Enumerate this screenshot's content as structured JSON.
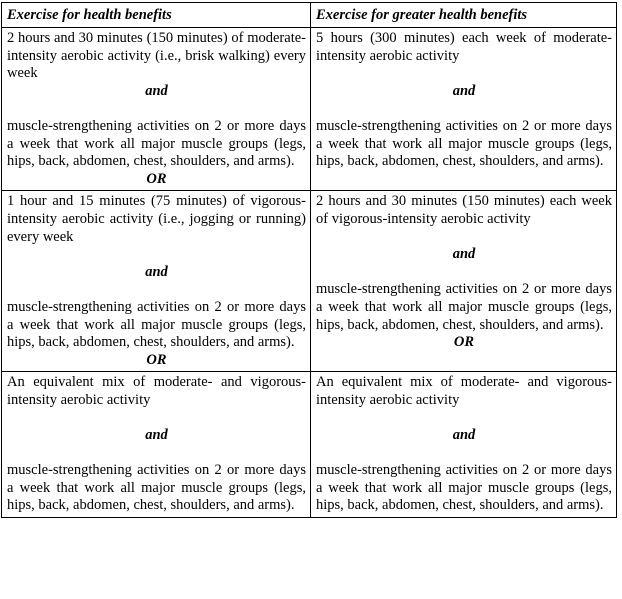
{
  "table": {
    "headers": [
      "Exercise for health benefits",
      "Exercise for greater health benefits"
    ],
    "strengthening_text_a": "muscle-strengthening activities on 2 or more days a week that work all major muscle groups (legs, hips, back, abdomen, chest, shoulders, and arms).",
    "conjunction_and": "and",
    "conjunction_or": "OR",
    "rows": [
      {
        "left": {
          "aerobic": "2 hours and 30 minutes (150 minutes) of moderate-intensity aerobic activity (i.e., brisk walking) every week",
          "and": "and",
          "strengthening": "muscle-strengthening activities on 2 or more days a week that work all major muscle groups (legs, hips, back, abdomen, chest, shoulders, and arms).",
          "or": "OR"
        },
        "right": {
          "aerobic": "5 hours (300 minutes) each week of moderate-intensity aerobic activity",
          "and": "and",
          "strengthening": "muscle-strengthening activities on 2 or more days a week that work all major muscle groups (legs, hips, back, abdomen, chest, shoulders, and arms).",
          "or": ""
        }
      },
      {
        "left": {
          "aerobic": "1 hour and 15 minutes (75 minutes) of vigorous-intensity aerobic activity (i.e., jogging or running) every week",
          "and": "and",
          "strengthening": "muscle-strengthening activities on 2 or more days a week that work all major muscle groups (legs, hips, back, abdomen, chest, shoulders, and arms).",
          "or": "OR"
        },
        "right": {
          "aerobic": "2 hours and 30 minutes (150 minutes) each week of vigorous-intensity aerobic activity",
          "and": "and",
          "strengthening": "muscle-strengthening activities on 2 or more days a week that work all major muscle groups (legs, hips, back, abdomen, chest, shoulders, and arms).",
          "or": "OR"
        }
      },
      {
        "left": {
          "aerobic": "An equivalent mix of moderate- and vigorous-intensity aerobic activity",
          "and": "and",
          "strengthening": "muscle-strengthening activities on 2 or more days a week that work all major muscle groups (legs, hips, back, abdomen, chest, shoulders, and arms).",
          "or": ""
        },
        "right": {
          "aerobic": "An equivalent mix of moderate- and vigorous-intensity aerobic activity",
          "and": "and",
          "strengthening": "muscle-strengthening activities on 2 or more days a week that work all major muscle groups (legs, hips, back, abdomen, chest, shoulders, and arms).",
          "or": ""
        }
      }
    ]
  },
  "style": {
    "border_color": "#000000",
    "text_color": "#000000",
    "background": "#ffffff"
  }
}
